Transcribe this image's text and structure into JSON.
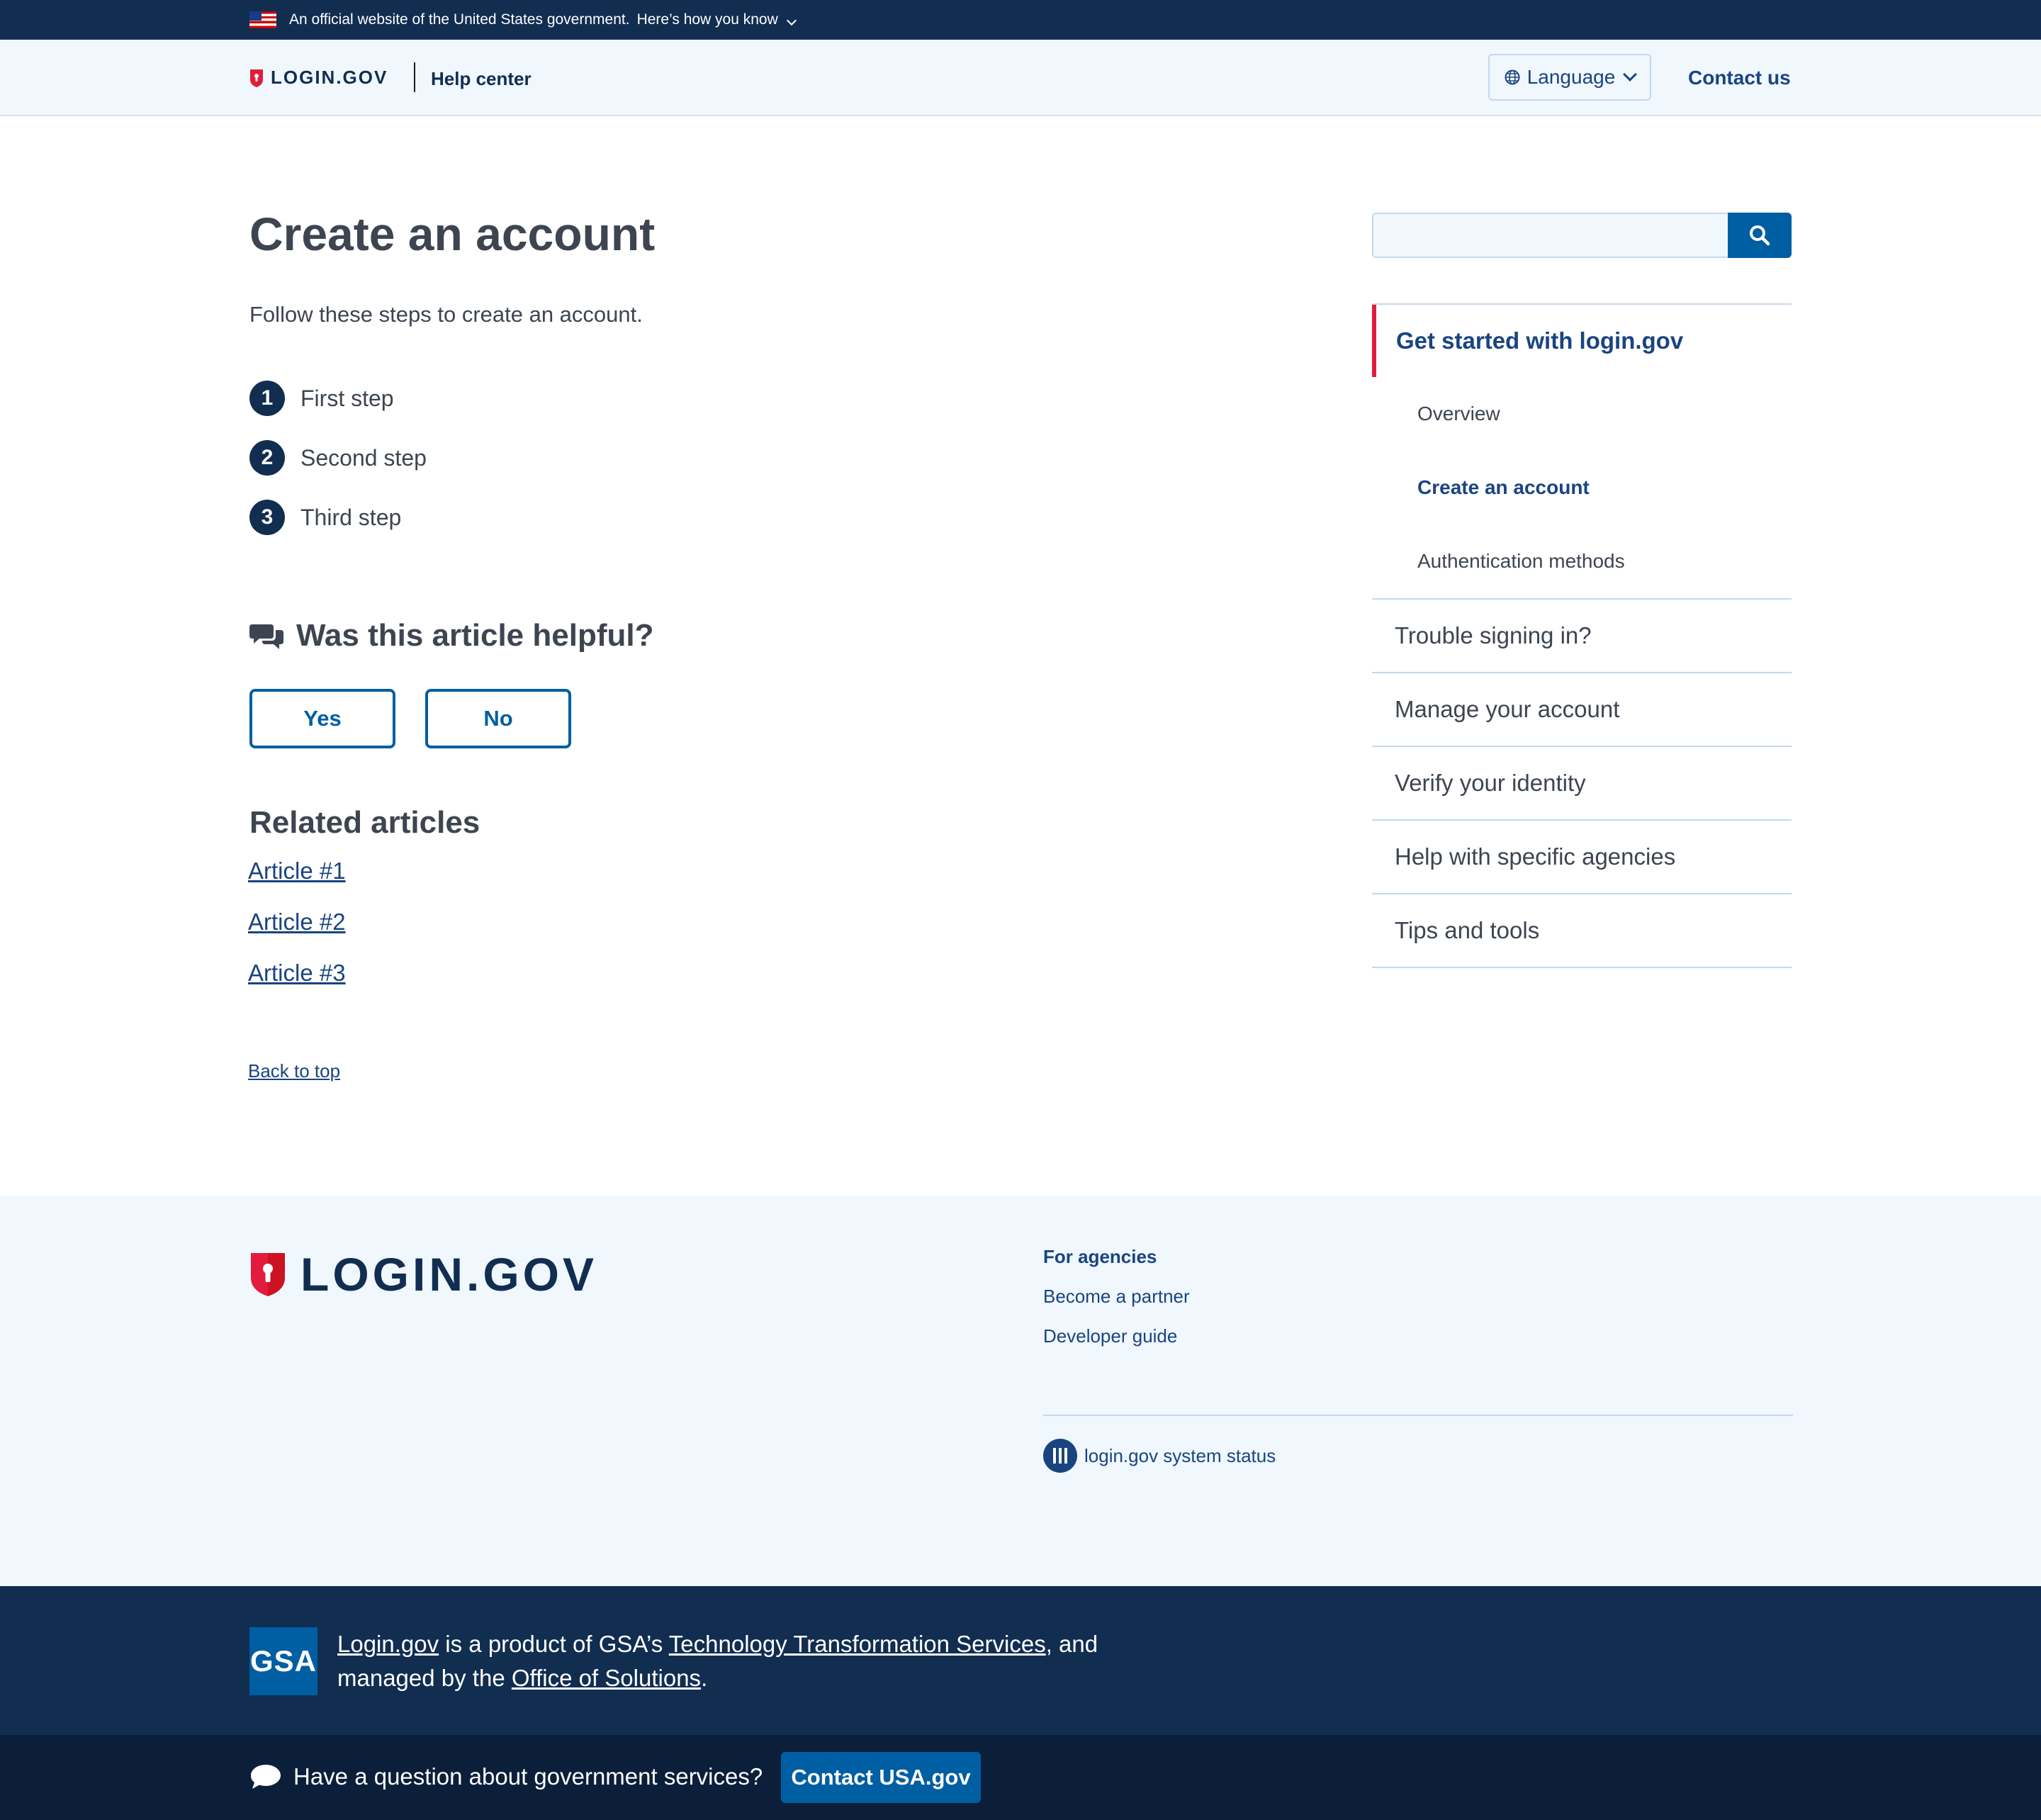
{
  "gov_banner": {
    "text": "An official website of the United States government.",
    "how_you_know": "Here’s how you know"
  },
  "header": {
    "logo_text": "LOGIN.GOV",
    "section": "Help center",
    "language_label": "Language",
    "contact_label": "Contact us"
  },
  "main": {
    "title": "Create an account",
    "intro": "Follow these steps to create an account.",
    "steps": [
      {
        "num": "1",
        "label": "First step"
      },
      {
        "num": "2",
        "label": "Second step"
      },
      {
        "num": "3",
        "label": "Third step"
      }
    ],
    "helpful_heading": "Was this article helpful?",
    "yes_label": "Yes",
    "no_label": "No",
    "related_heading": "Related articles",
    "related": [
      "Article #1",
      "Article #2",
      "Article #3"
    ],
    "back_to_top": "Back to top"
  },
  "sidebar": {
    "search_placeholder": "",
    "current_section": "Get started with login.gov",
    "subitems": [
      "Overview",
      "Create an account",
      "Authentication methods"
    ],
    "items": [
      "Trouble signing in?",
      "Manage your account",
      "Verify your identity",
      "Help with specific agencies",
      "Tips and tools"
    ]
  },
  "footer": {
    "logo_text": "LOGIN.GOV",
    "links_heading": "For agencies",
    "links": [
      "Become a partner",
      "Developer guide"
    ],
    "status_label": "login.gov system status"
  },
  "gsa": {
    "logo_text": "GSA",
    "link_login": "Login.gov",
    "text_1": " is a product of GSA’s ",
    "link_tts": "Technology Transformation Services",
    "text_2": ", and managed by the ",
    "link_office": "Office of Solutions",
    "text_3": "."
  },
  "usa_bar": {
    "question": "Have a question about government services?",
    "button": "Contact USA.gov"
  },
  "colors": {
    "navy": "#112e51",
    "primary": "#005ea2",
    "link": "#1a4480",
    "accent_red": "#e21c3d",
    "light_bg": "#f0f7fd"
  }
}
